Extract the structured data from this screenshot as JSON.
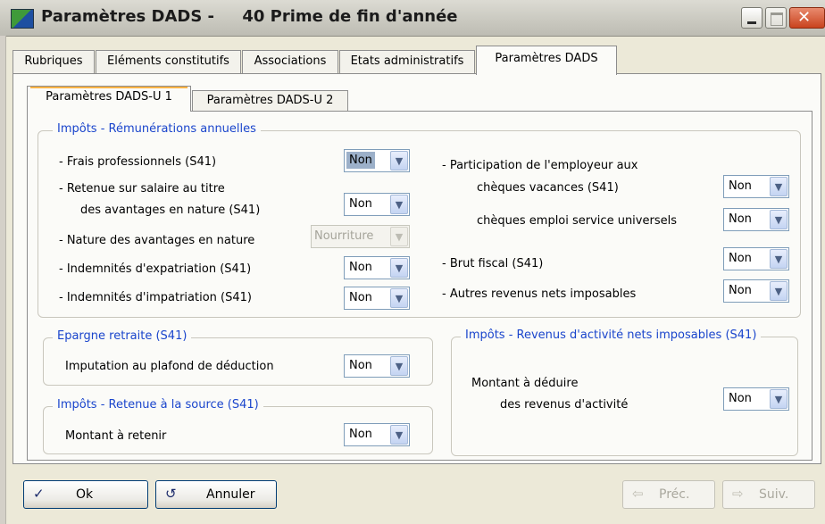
{
  "window": {
    "title": "Paramètres DADS -     40 Prime de fin d'année"
  },
  "tabs": [
    {
      "label": "Rubriques"
    },
    {
      "label": "Eléments constitutifs"
    },
    {
      "label": "Associations"
    },
    {
      "label": "Etats administratifs"
    },
    {
      "label": "Paramètres DADS"
    }
  ],
  "subtabs": [
    {
      "label": "Paramètres DADS-U 1"
    },
    {
      "label": "Paramètres DADS-U 2"
    }
  ],
  "groups": {
    "remunerations": {
      "title": "Impôts - Rémunérations annuelles",
      "frais_label": "- Frais professionnels (S41)",
      "frais_value": "Non",
      "retenue_label_1": "- Retenue sur salaire au titre",
      "retenue_label_2": "des avantages en nature (S41)",
      "retenue_value": "Non",
      "nature_label": "- Nature des avantages en nature",
      "nature_value": "Nourriture",
      "expatriation_label": "- Indemnités d'expatriation (S41)",
      "expatriation_value": "Non",
      "impatriation_label": "- Indemnités d'impatriation (S41)",
      "impatriation_value": "Non",
      "participation_label": "- Participation de l'employeur aux",
      "cheques_vacances_label": "chèques vacances (S41)",
      "cheques_vacances_value": "Non",
      "cesu_label": "chèques emploi service universels",
      "cesu_value": "Non",
      "brut_fiscal_label": "- Brut fiscal (S41)",
      "brut_fiscal_value": "Non",
      "autres_revenus_label": "- Autres revenus nets imposables",
      "autres_revenus_value": "Non"
    },
    "epargne": {
      "title": "Epargne retraite (S41)",
      "imputation_label": "Imputation au plafond de déduction",
      "imputation_value": "Non"
    },
    "retenue_source": {
      "title": "Impôts - Retenue à la source (S41)",
      "montant_label": "Montant à retenir",
      "montant_value": "Non"
    },
    "revenus_activite": {
      "title": "Impôts - Revenus d'activité nets imposables (S41)",
      "montant_label_1": "Montant à déduire",
      "montant_label_2": "des revenus d'activité",
      "montant_value": "Non"
    }
  },
  "buttons": {
    "ok": "Ok",
    "annuler": "Annuler",
    "prec": "Préc.",
    "suiv": "Suiv."
  },
  "icons": {
    "app": "app-icon",
    "ok": "check-icon",
    "cancel": "cancel-icon",
    "prev": "arrow-left-icon",
    "next": "arrow-right-icon",
    "dropdown": "chevron-down-icon"
  }
}
